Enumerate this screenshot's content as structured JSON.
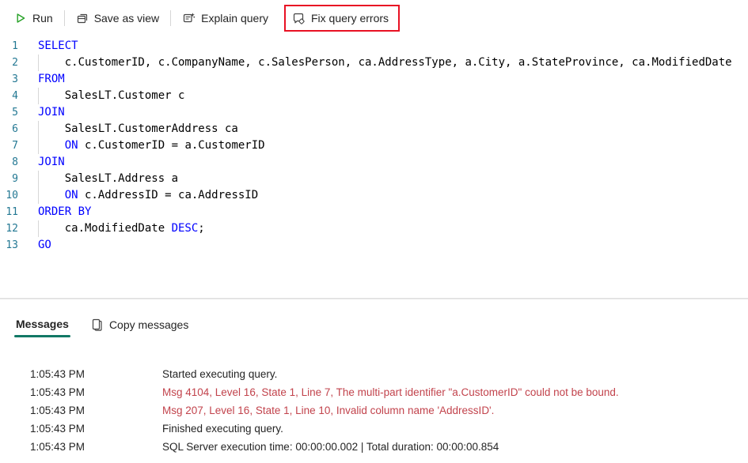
{
  "toolbar": {
    "run_label": "Run",
    "save_as_view_label": "Save as view",
    "explain_query_label": "Explain query",
    "fix_query_errors_label": "Fix query errors"
  },
  "sql": {
    "lines": [
      {
        "n": "1",
        "indent": false,
        "segs": [
          {
            "t": "SELECT",
            "k": true
          }
        ]
      },
      {
        "n": "2",
        "indent": true,
        "segs": [
          {
            "t": "    c.CustomerID, c.CompanyName, c.SalesPerson, ca.AddressType, a.City, a.StateProvince, ca.ModifiedDate",
            "k": false
          }
        ]
      },
      {
        "n": "3",
        "indent": false,
        "segs": [
          {
            "t": "FROM",
            "k": true
          }
        ]
      },
      {
        "n": "4",
        "indent": true,
        "segs": [
          {
            "t": "    SalesLT.Customer c",
            "k": false
          }
        ]
      },
      {
        "n": "5",
        "indent": false,
        "segs": [
          {
            "t": "JOIN",
            "k": true
          }
        ]
      },
      {
        "n": "6",
        "indent": true,
        "segs": [
          {
            "t": "    SalesLT.CustomerAddress ca",
            "k": false
          }
        ]
      },
      {
        "n": "7",
        "indent": true,
        "segs": [
          {
            "t": "    ",
            "k": false
          },
          {
            "t": "ON",
            "k": true
          },
          {
            "t": " c.CustomerID = a.CustomerID",
            "k": false
          }
        ]
      },
      {
        "n": "8",
        "indent": false,
        "segs": [
          {
            "t": "JOIN",
            "k": true
          }
        ]
      },
      {
        "n": "9",
        "indent": true,
        "segs": [
          {
            "t": "    SalesLT.Address a",
            "k": false
          }
        ]
      },
      {
        "n": "10",
        "indent": true,
        "segs": [
          {
            "t": "    ",
            "k": false
          },
          {
            "t": "ON",
            "k": true
          },
          {
            "t": " c.AddressID = ca.AddressID",
            "k": false
          }
        ]
      },
      {
        "n": "11",
        "indent": false,
        "segs": [
          {
            "t": "ORDER BY",
            "k": true
          }
        ]
      },
      {
        "n": "12",
        "indent": true,
        "segs": [
          {
            "t": "    ca.ModifiedDate ",
            "k": false
          },
          {
            "t": "DESC",
            "k": true
          },
          {
            "t": ";",
            "k": false
          }
        ]
      },
      {
        "n": "13",
        "indent": false,
        "segs": [
          {
            "t": "GO",
            "k": true
          }
        ]
      }
    ]
  },
  "messages": {
    "tab_label": "Messages",
    "copy_label": "Copy messages",
    "rows": [
      {
        "time": "1:05:43 PM",
        "text": "Started executing query.",
        "type": "normal"
      },
      {
        "time": "1:05:43 PM",
        "text": "Msg 4104, Level 16, State 1, Line 7, The multi-part identifier \"a.CustomerID\" could not be bound.",
        "type": "error"
      },
      {
        "time": "1:05:43 PM",
        "text": "Msg 207, Level 16, State 1, Line 10, Invalid column name 'AddressID'.",
        "type": "error"
      },
      {
        "time": "1:05:43 PM",
        "text": "Finished executing query.",
        "type": "normal"
      },
      {
        "time": "1:05:43 PM",
        "text": "SQL Server execution time: 00:00:00.002 | Total duration: 00:00:00.854",
        "type": "normal"
      }
    ]
  },
  "colors": {
    "keyword": "#0000FF",
    "line_number": "#237893",
    "error_text": "#C2434C",
    "tab_accent": "#117865",
    "run_green": "#26A126",
    "highlight_red": "#E81123",
    "icon_gray": "#424242"
  }
}
